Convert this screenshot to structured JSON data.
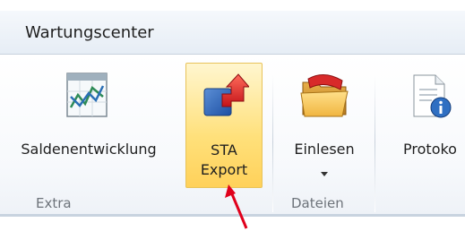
{
  "ribbon": {
    "tab_title": "Wartungscenter",
    "buttons": [
      {
        "label_line1": "Saldenentwicklung",
        "label_line2": "",
        "icon": "chart-icon"
      },
      {
        "label_line1": "STA",
        "label_line2": "Export",
        "icon": "export-arrow-icon",
        "selected": true
      },
      {
        "label_line1": "Einlesen",
        "label_line2": "",
        "icon": "folder-icon",
        "has_dropdown": true
      },
      {
        "label_line1": "Protoko",
        "label_line2": "",
        "icon": "document-info-icon"
      }
    ],
    "groups": [
      {
        "label": "Extra"
      },
      {
        "label": "Dateien"
      }
    ]
  },
  "colors": {
    "selected_bg": "#ffd15a",
    "annotation_arrow": "#e0001b"
  }
}
